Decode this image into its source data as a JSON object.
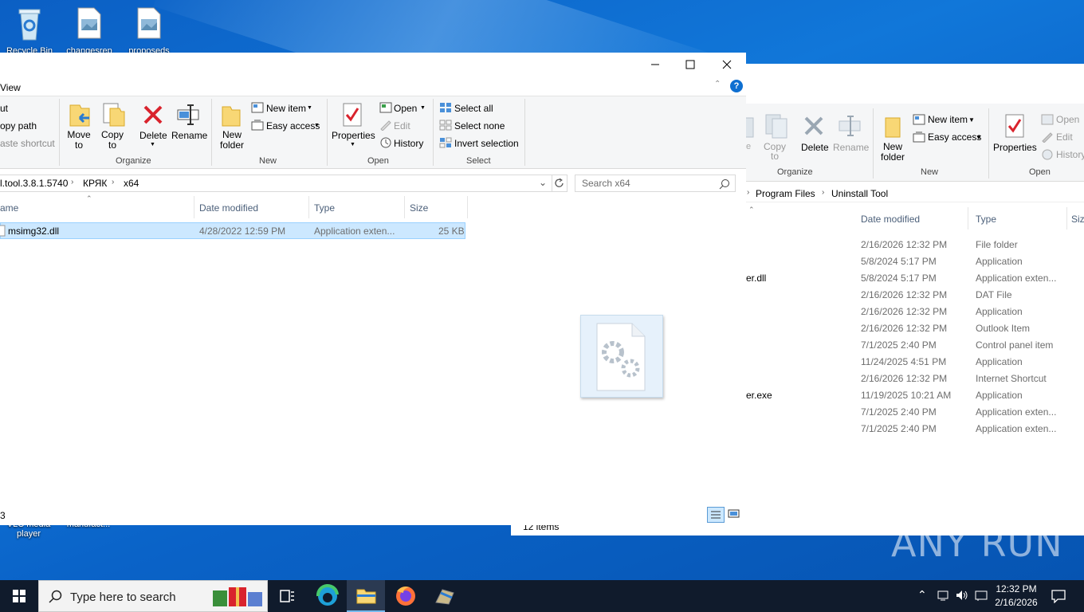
{
  "desktop": {
    "icons": [
      {
        "label": "Recycle Bin",
        "kind": "recycle-bin-icon"
      },
      {
        "label": "changesrep",
        "kind": "image-file-icon"
      },
      {
        "label": "proposeds",
        "kind": "image-file-icon"
      },
      {
        "label": "VLC media player",
        "kind": "vlc-icon"
      },
      {
        "label": "manufact...",
        "kind": "file-icon"
      }
    ],
    "watermark": "ANY RUN"
  },
  "front_window": {
    "tab_view": "View",
    "ribbon": {
      "clipboard": [
        "ut",
        "opy path",
        "aste shortcut"
      ],
      "organize": {
        "move_to": "Move to",
        "copy_to": "Copy to",
        "delete": "Delete",
        "rename": "Rename",
        "group": "Organize"
      },
      "new": {
        "new_folder": "New folder",
        "new_item": "New item",
        "easy_access": "Easy access",
        "group": "New"
      },
      "open": {
        "properties": "Properties",
        "open": "Open",
        "edit": "Edit",
        "history": "History",
        "group": "Open"
      },
      "select": {
        "select_all": "Select all",
        "select_none": "Select none",
        "invert_selection": "Invert selection",
        "group": "Select"
      }
    },
    "path": [
      "l.tool.3.8.1.5740",
      "КРЯК",
      "x64"
    ],
    "search_placeholder": "Search x64",
    "columns": [
      "ame",
      "Date modified",
      "Type",
      "Size"
    ],
    "files": [
      {
        "name": "msimg32.dll",
        "date": "4/28/2022 12:59 PM",
        "type": "Application exten...",
        "size": "25 KB"
      }
    ],
    "status_count": "3"
  },
  "back_window": {
    "ribbon": {
      "organize": {
        "move_to": "e",
        "copy_to": "Copy to",
        "delete": "Delete",
        "rename": "Rename",
        "group": "Organize"
      },
      "new": {
        "new_folder": "New folder",
        "new_item": "New item",
        "easy_access": "Easy access",
        "group": "New"
      },
      "open": {
        "properties": "Properties",
        "open": "Open",
        "edit": "Edit",
        "history": "History",
        "group": "Open"
      }
    },
    "path": [
      "Program Files",
      "Uninstall Tool"
    ],
    "columns": [
      "Date modified",
      "Type",
      "Siz"
    ],
    "files": [
      {
        "name": "",
        "date": "2/16/2026 12:32 PM",
        "type": "File folder"
      },
      {
        "name": "",
        "date": "5/8/2024 5:17 PM",
        "type": "Application"
      },
      {
        "name": "er.dll",
        "date": "5/8/2024 5:17 PM",
        "type": "Application exten..."
      },
      {
        "name": "",
        "date": "2/16/2026 12:32 PM",
        "type": "DAT File"
      },
      {
        "name": "",
        "date": "2/16/2026 12:32 PM",
        "type": "Application"
      },
      {
        "name": "",
        "date": "2/16/2026 12:32 PM",
        "type": "Outlook Item"
      },
      {
        "name": "",
        "date": "7/1/2025 2:40 PM",
        "type": "Control panel item"
      },
      {
        "name": "",
        "date": "11/24/2025 4:51 PM",
        "type": "Application"
      },
      {
        "name": "",
        "date": "2/16/2026 12:32 PM",
        "type": "Internet Shortcut"
      },
      {
        "name": "er.exe",
        "date": "11/19/2025 10:21 AM",
        "type": "Application"
      },
      {
        "name": "",
        "date": "7/1/2025 2:40 PM",
        "type": "Application exten..."
      },
      {
        "name": "",
        "date": "7/1/2025 2:40 PM",
        "type": "Application exten..."
      }
    ],
    "status_count": "12 items"
  },
  "taskbar": {
    "search_placeholder": "Type here to search",
    "time": "12:32 PM",
    "date": "2/16/2026"
  },
  "colors": {
    "selection": "#cce8ff",
    "accent": "#0078d7",
    "taskbar": "#101b2c"
  }
}
